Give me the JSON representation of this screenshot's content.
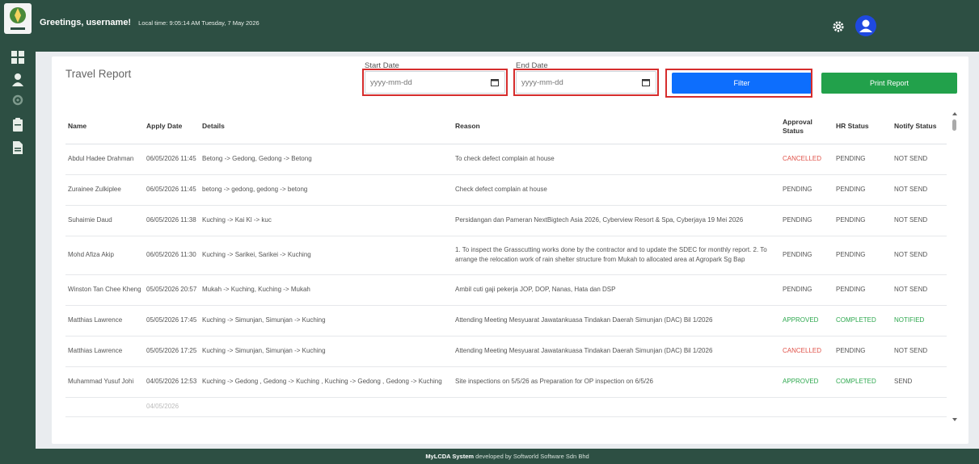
{
  "header": {
    "greeting": "Greetings, username!",
    "local_time": "Local time: 9:05:14 AM Tuesday, 7 May 2026"
  },
  "page": {
    "title": "Travel Report",
    "start_date_label": "Start Date",
    "end_date_label": "End Date",
    "date_placeholder": "yyyy-mm-dd",
    "filter_button": "Filter",
    "print_button": "Print Report"
  },
  "table": {
    "columns": [
      "Name",
      "Apply Date",
      "Details",
      "Reason",
      "Approval Status",
      "HR Status",
      "Notify Status"
    ],
    "rows": [
      {
        "name": "Abdul Hadee Drahman",
        "date": "06/05/2026 11:45",
        "details": "Betong -> Gedong, Gedong -> Betong",
        "reason": "To check defect complain at house",
        "approval": "CANCELLED",
        "hr": "PENDING",
        "notify": "NOT SEND"
      },
      {
        "name": "Zurainee Zulkiplee",
        "date": "06/05/2026 11:45",
        "details": "betong -> gedong, gedong -> betong",
        "reason": "Check defect complain at house",
        "approval": "PENDING",
        "hr": "PENDING",
        "notify": "NOT SEND"
      },
      {
        "name": "Suhaimie Daud",
        "date": "06/05/2026 11:38",
        "details": "Kuching -> Kai Kl -> kuc",
        "reason": "Persidangan dan Pameran NextBigtech Asia 2026, Cyberview Resort & Spa, Cyberjaya 19 Mei 2026",
        "approval": "PENDING",
        "hr": "PENDING",
        "notify": "NOT SEND"
      },
      {
        "name": "Mohd Afiza Akip",
        "date": "06/05/2026 11:30",
        "details": "Kuching -> Sarikei, Sarikei -> Kuching",
        "reason": "1. To inspect the Grasscutting works done by the contractor and to update the SDEC for monthly report. 2. To arrange the relocation work of rain shelter structure from Mukah to allocated area at Agropark Sg Bap",
        "approval": "PENDING",
        "hr": "PENDING",
        "notify": "NOT SEND"
      },
      {
        "name": "Winston Tan Chee Kheng",
        "date": "05/05/2026 20:57",
        "details": "Mukah -> Kuching, Kuching -> Mukah",
        "reason": "Ambil cuti gaji pekerja JOP, DOP, Nanas, Hata dan DSP",
        "approval": "PENDING",
        "hr": "PENDING",
        "notify": "NOT SEND"
      },
      {
        "name": "Matthias Lawrence",
        "date": "05/05/2026 17:45",
        "details": "Kuching -> Simunjan, Simunjan -> Kuching",
        "reason": "Attending Meeting Mesyuarat Jawatankuasa Tindakan Daerah Simunjan (DAC) Bil 1/2026",
        "approval": "APPROVED",
        "hr": "COMPLETED",
        "notify": "NOTIFIED"
      },
      {
        "name": "Matthias Lawrence",
        "date": "05/05/2026 17:25",
        "details": "Kuching -> Simunjan, Simunjan -> Kuching",
        "reason": "Attending Meeting Mesyuarat Jawatankuasa Tindakan Daerah Simunjan (DAC) Bil 1/2026",
        "approval": "CANCELLED",
        "hr": "PENDING",
        "notify": "NOT SEND"
      },
      {
        "name": "Muhammad Yusuf Johi",
        "date": "04/05/2026 12:53",
        "details": "Kuching -> Gedong , Gedong -> Kuching , Kuching -> Gedong , Gedong -> Kuching",
        "reason": "Site inspections on 5/5/26 as Preparation for OP inspection on 6/5/26",
        "approval": "APPROVED",
        "hr": "COMPLETED",
        "notify": "SEND"
      },
      {
        "name": "",
        "date": "04/05/2026",
        "details": "",
        "reason": "",
        "approval": "",
        "hr": "",
        "notify": ""
      }
    ]
  },
  "footer": {
    "system": "MyLCDA System",
    "credit": "developed by Softworld Software Sdn Bhd"
  },
  "colors": {
    "brand": "#2d4f43",
    "filter": "#0d6efd",
    "print": "#22a14b",
    "cancelled": "#e05249",
    "approved": "#2ea84f",
    "highlight": "#d62d2d"
  }
}
